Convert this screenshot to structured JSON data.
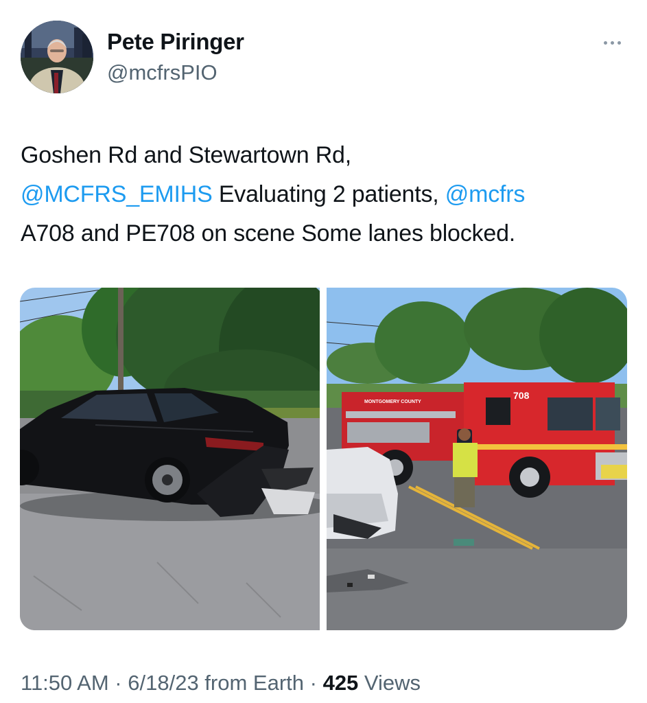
{
  "author": {
    "display_name": "Pete Piringer",
    "handle": "@mcfrsPIO",
    "avatar_icon": "profile-photo"
  },
  "more_icon": "ellipsis-icon",
  "tweet": {
    "line1": "Goshen Rd and Stewartown Rd,",
    "mention1": "@MCFRS_EMIHS",
    "line2_text": " Evaluating 2 patients, ",
    "mention2": "@mcfrs",
    "line3": "A708 and PE708 on scene Some lanes blocked."
  },
  "media": {
    "photo1_icon": "damaged-black-sedan-photo",
    "photo2_icon": "fire-engine-scene-photo",
    "engine_number": "708",
    "engine_county": "MONTGOMERY COUNTY"
  },
  "meta": {
    "time": "11:50 AM",
    "sep1": " · ",
    "date": "6/18/23",
    "source": " from Earth",
    "sep2": " · ",
    "views_count": "425",
    "views_label": " Views"
  },
  "colors": {
    "link": "#1d9bf0",
    "secondary_text": "#536471",
    "primary_text": "#0f1419"
  }
}
